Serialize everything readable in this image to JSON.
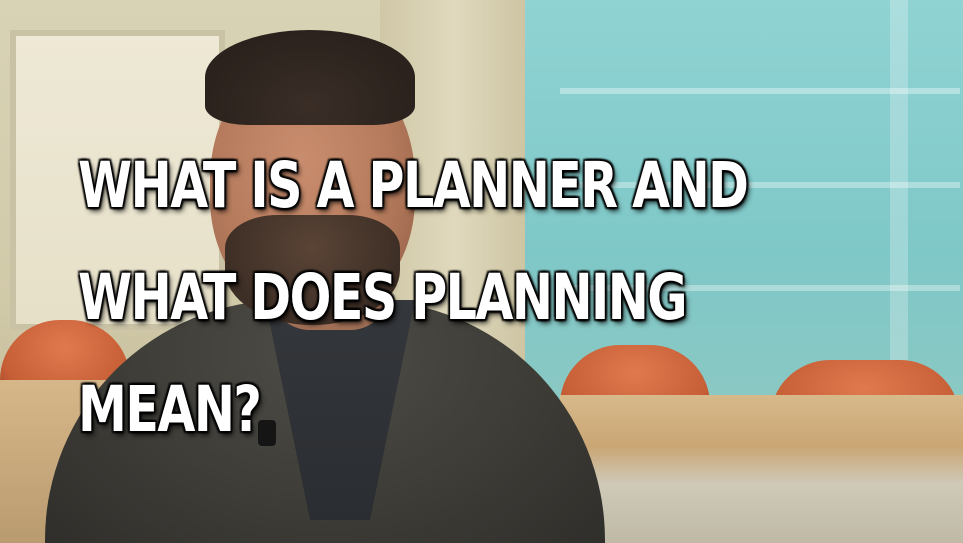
{
  "caption": {
    "lines": [
      "WHAT IS A PLANNER AND",
      "WHAT DOES PLANNING",
      "MEAN?"
    ]
  }
}
